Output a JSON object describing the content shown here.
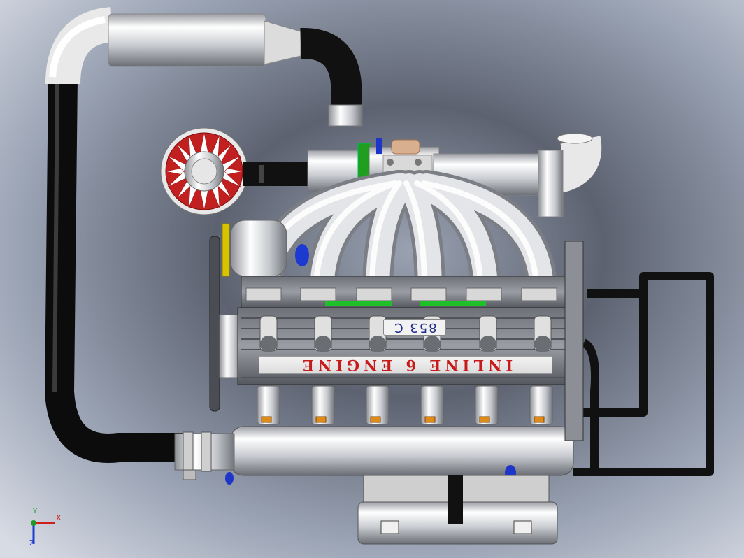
{
  "viewport": {
    "engine_label": "INLINE 6 ENGINE",
    "badge_label": "853 C",
    "axis_labels": {
      "x": "X",
      "y": "Y",
      "z": "Z"
    }
  },
  "colors": {
    "background_light": "#dfe4ee",
    "background_dark": "#3f4450",
    "hose_black": "#151515",
    "metal_light": "#f2f2f2",
    "metal_mid": "#b9bcc2",
    "engine_text_red": "#c71a1a",
    "badge_text_blue": "#1d2b8a",
    "turbine_red": "#b01010",
    "valve_green": "#21c21f"
  }
}
